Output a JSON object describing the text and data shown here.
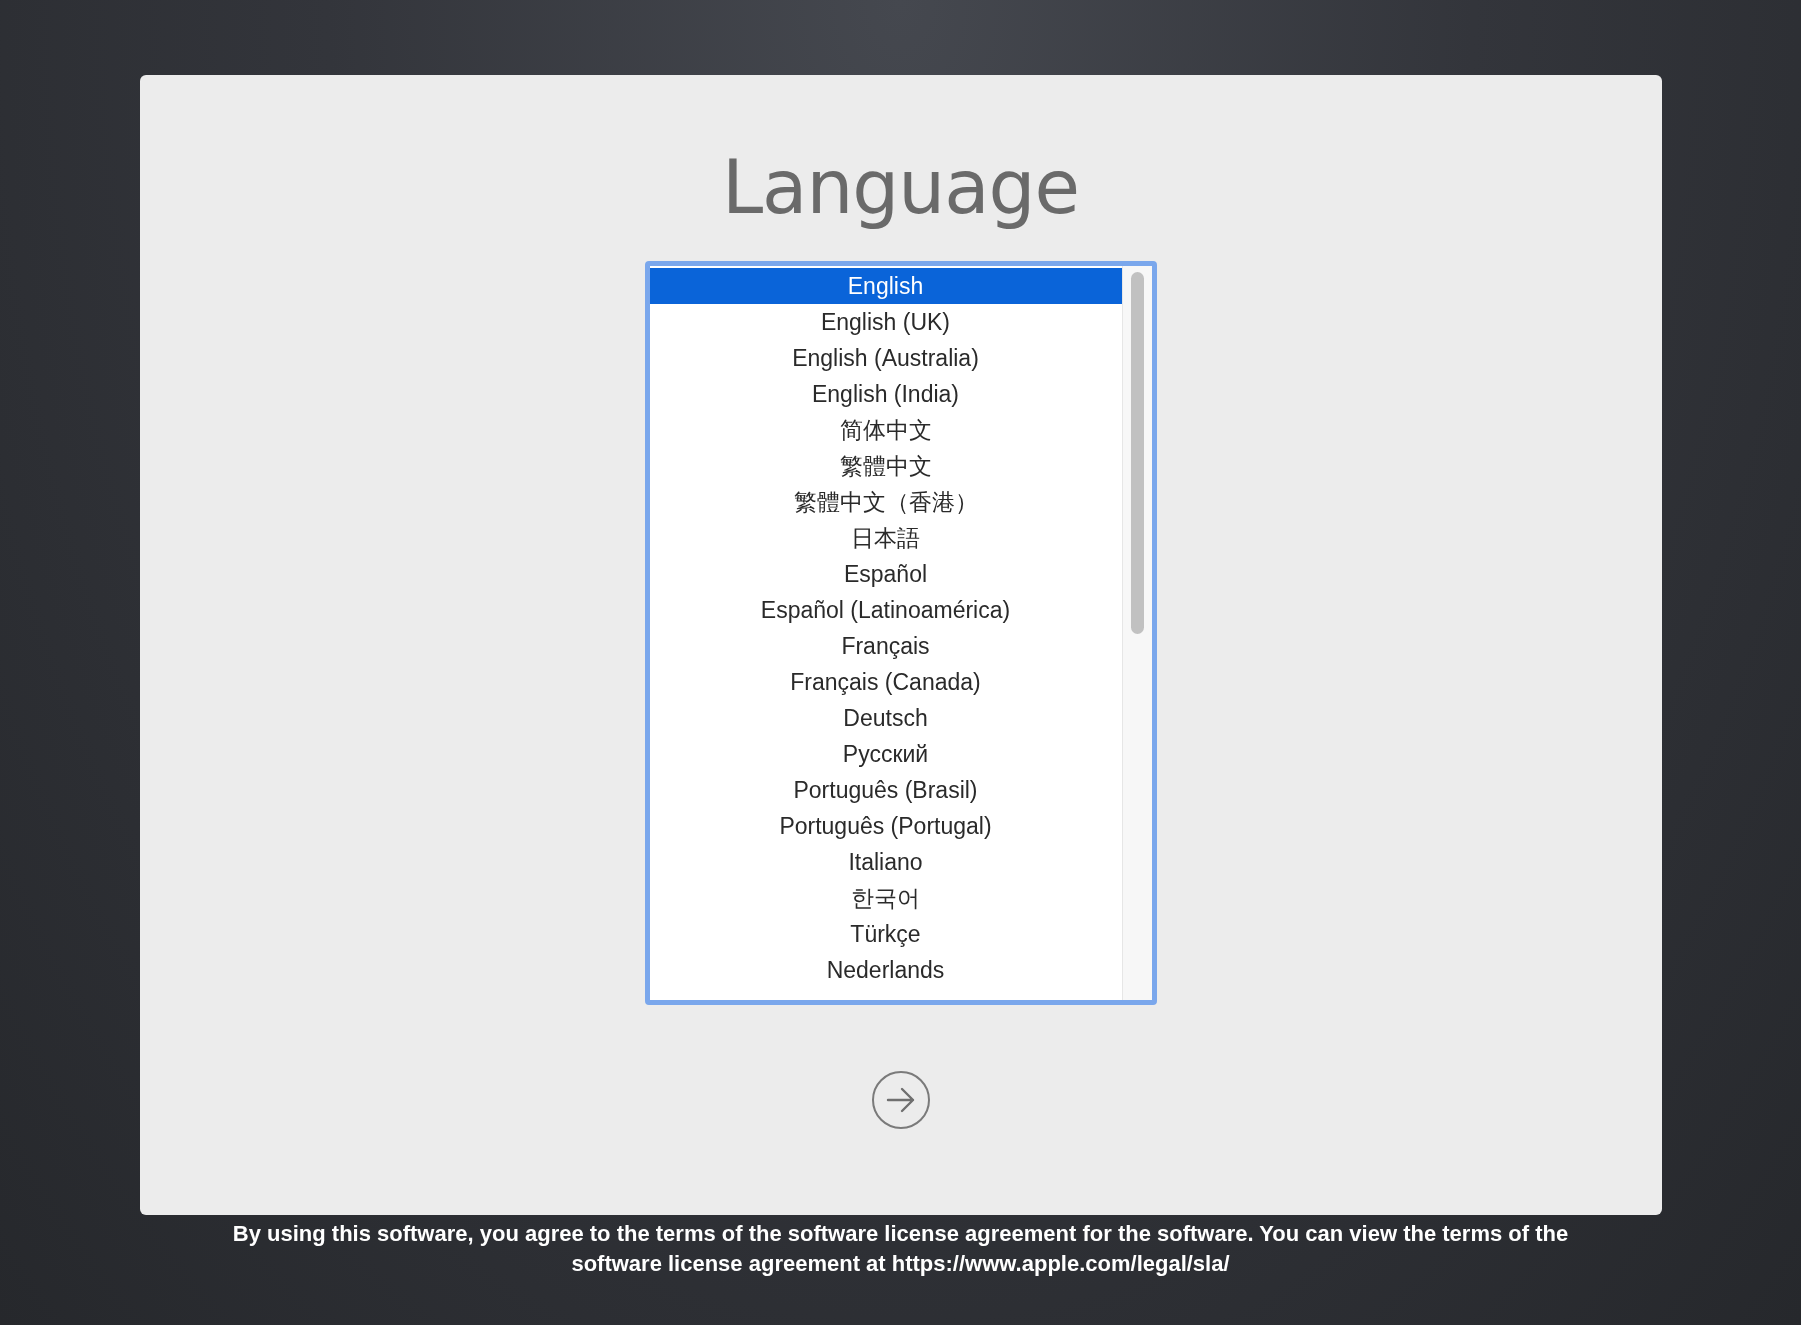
{
  "title": "Language",
  "languages": [
    {
      "label": "English",
      "selected": true
    },
    {
      "label": "English (UK)",
      "selected": false
    },
    {
      "label": "English (Australia)",
      "selected": false
    },
    {
      "label": "English (India)",
      "selected": false
    },
    {
      "label": "简体中文",
      "selected": false
    },
    {
      "label": "繁體中文",
      "selected": false
    },
    {
      "label": "繁體中文（香港）",
      "selected": false
    },
    {
      "label": "日本語",
      "selected": false
    },
    {
      "label": "Español",
      "selected": false
    },
    {
      "label": "Español (Latinoamérica)",
      "selected": false
    },
    {
      "label": "Français",
      "selected": false
    },
    {
      "label": "Français (Canada)",
      "selected": false
    },
    {
      "label": "Deutsch",
      "selected": false
    },
    {
      "label": "Русский",
      "selected": false
    },
    {
      "label": "Português (Brasil)",
      "selected": false
    },
    {
      "label": "Português (Portugal)",
      "selected": false
    },
    {
      "label": "Italiano",
      "selected": false
    },
    {
      "label": "한국어",
      "selected": false
    },
    {
      "label": "Türkçe",
      "selected": false
    },
    {
      "label": "Nederlands",
      "selected": false
    }
  ],
  "license_notice": "By using this software, you agree to the terms of the software license agreement for the software. You can view the terms of the software license agreement at https://www.apple.com/legal/sla/"
}
